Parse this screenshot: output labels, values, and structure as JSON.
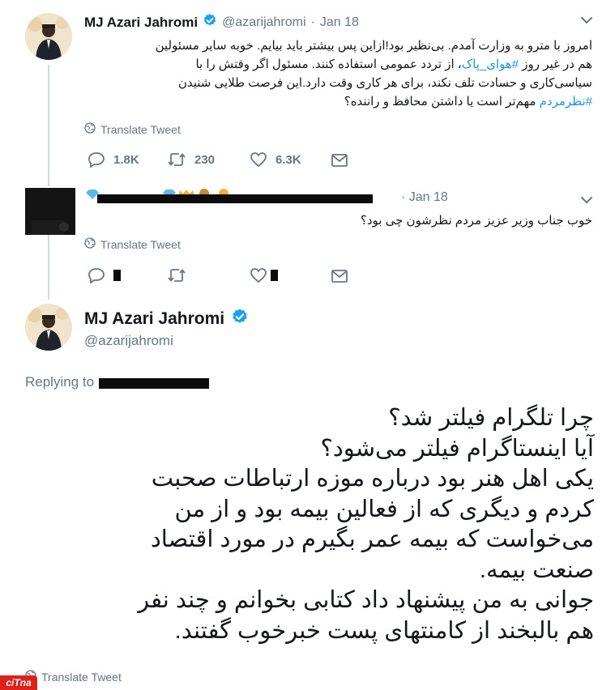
{
  "tweet1": {
    "name": "MJ Azari Jahromi",
    "handle": "@azarijahromi",
    "sep": "·",
    "date": "Jan 18",
    "line1": "امروز با مترو به وزارت آمدم. بی‌نظیر بود!ازاین پس بیشتر باید بیایم. خوبه سایر مسئولین",
    "line2_pre": "هم در غیر روز ",
    "line2_tag": "#هوای_پاک",
    "line2_post": "، از تردد عمومی استفاده کنند. مسئول اگر وقتش را با",
    "line3": "سیاسی‌کاری و حسادت تلف نکند، برای هر کاری وقت دارد.این فرصت طلایی شنیدن",
    "line4_tag": "#نظرمردم",
    "line4_post": " مهم‌تر است یا داشتن محافظ و راننده؟",
    "translate": "Translate Tweet",
    "reply_count": "1.8K",
    "retweet_count": "230",
    "like_count": "6.3K"
  },
  "tweet2": {
    "date": "· Jan 18",
    "text": "خوب جناب وزیر عزیز مردم نظرشون چی بود؟",
    "translate": "Translate Tweet"
  },
  "tweet3": {
    "name": "MJ Azari Jahromi",
    "handle": "@azarijahromi",
    "replying_to": "Replying to",
    "line1": "چرا تلگرام فیلتر شد؟",
    "line2": "آیا اینستاگرام فیلتر می‌شود؟",
    "line3": "یکی اهل هنر بود درباره موزه ارتباطات صحبت",
    "line4": "کردم و دیگری که از فعالین بیمه بود و از من",
    "line5": "می‌خواست که بیمه عمر بگیرم در مورد اقتصاد",
    "line6": "صنعت بیمه.",
    "line7": "جوانی به من پیشنهاد داد کتابی بخوانم و چند نفر",
    "line8": "هم بالبخند از کامنتهای پست خبرخوب گفتند.",
    "translate": "Translate Tweet"
  },
  "watermark": "ciTna",
  "colors": {
    "verified": "#1da1f2",
    "link": "#1b95e0",
    "secondary": "#657786",
    "watermark_bg": "#e0201a"
  }
}
